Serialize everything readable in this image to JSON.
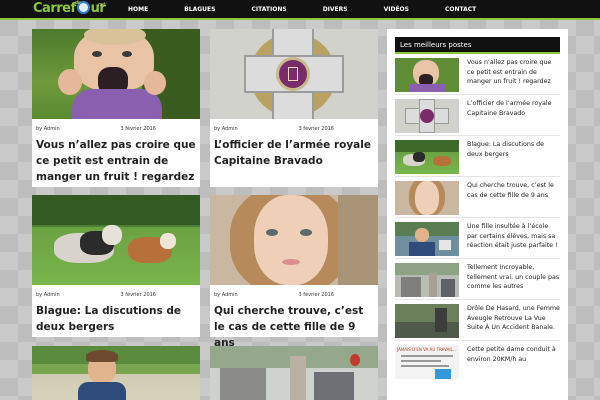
{
  "site": {
    "logo_main": "Carref",
    "logo_end": "ur",
    "logo_small_top": "de",
    "logo_small_right": ".net"
  },
  "nav": {
    "items": [
      "HOME",
      "BLAGUES",
      "CITATIONS",
      "DIVERS",
      "VIDÉOS",
      "CONTACT"
    ]
  },
  "posts": [
    {
      "author": "by Admin",
      "date": "3 février 2016",
      "title": "Vous n’allez pas croire que ce petit est entrain de manger un fruit ! regardez"
    },
    {
      "author": "by Admin",
      "date": "3 février 2016",
      "title": "L’officier de l’armée royale Capitaine Bravado"
    },
    {
      "author": "by Admin",
      "date": "3 février 2016",
      "title": "Blague: La discutions de deux bergers"
    },
    {
      "author": "by Admin",
      "date": "3 février 2016",
      "title": "Qui cherche trouve, c’est le cas de cette fille de 9 ans"
    }
  ],
  "sidebar": {
    "header": "Les meilleurs postes",
    "items": [
      {
        "text": "Vous n’allez pas croire que ce petit est entrain de manger un fruit ! regardez"
      },
      {
        "text": "L’officier de l’armée royale Capitaine Bravado"
      },
      {
        "text": "Blague: La discutions de deux bergers"
      },
      {
        "text": "Qui cherche trouve, c’est le cas de cette fille de 9 ans"
      },
      {
        "text": "Une fille insultée à l’école par certains élèves, mais sa réaction était juste parfaite !"
      },
      {
        "text": "Tellement incroyable, tellement vrai, un couple pas comme les autres"
      },
      {
        "text": "Drôle De Hasard, une Femme Aveugle Retrouve La Vue Suite À Un Accident Banale."
      },
      {
        "text": "Cette petite dame conduit à environ 20KM/h au"
      }
    ],
    "thumb7_caption": "JAMAIS D’EN VA AU TRAVAIL..."
  },
  "colors": {
    "accent": "#8cc63f",
    "nav_bg": "#111111",
    "title_text": "#222222"
  }
}
